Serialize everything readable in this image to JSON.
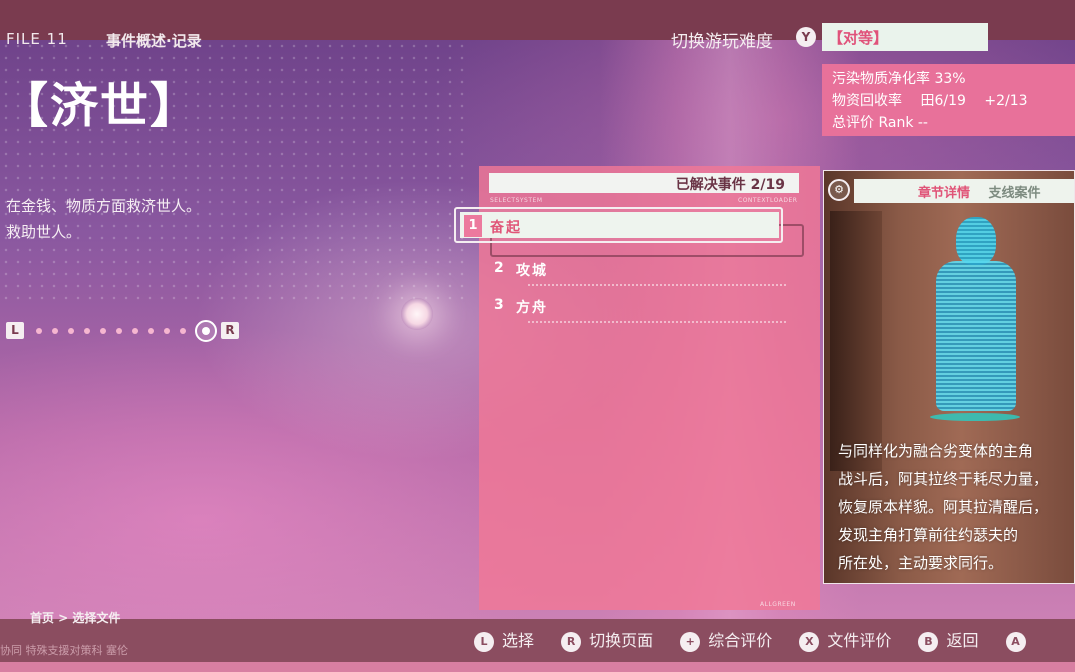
{
  "header": {
    "file_no": "FILE 11",
    "file_sub": "事件概述·记录",
    "title": "【济世】",
    "description": [
      "在金钱、物质方面救济世人。",
      "救助世人。"
    ]
  },
  "nav": {
    "left_btn": "L",
    "right_btn": "R"
  },
  "difficulty": {
    "label": "切换游玩难度",
    "button": "Y",
    "value": "【对等】"
  },
  "stats": {
    "purify": "污染物质净化率 33%",
    "recover_label": "物资回收率",
    "recover_a": "田6/19",
    "recover_b": "+2/13",
    "rank": "总评价 Rank --"
  },
  "panel": {
    "header": "已解决事件 2/19",
    "tiny_left": "SELECTSYSTEM",
    "tiny_right": "CONTEXTLOADER",
    "tiny_bottom": "ALLGREEN",
    "items": [
      {
        "num": "1",
        "label": "奋起"
      },
      {
        "num": "2",
        "label": "攻城"
      },
      {
        "num": "3",
        "label": "方舟"
      }
    ]
  },
  "card": {
    "medal": "⚙",
    "tab_active": "章节详情",
    "tab_inactive": "支线案件",
    "text": [
      "与同样化为融合劣变体的主角",
      "战斗后，阿其拉终于耗尽力量，",
      "恢复原本样貌。阿其拉清醒后，",
      "发现主角打算前往约瑟夫的",
      "所在处，主动要求同行。"
    ]
  },
  "breadcrumb": "首页 > 选择文件",
  "bottom_ghost": "协同   特殊支援对策科  塞伦",
  "hints": [
    {
      "key": "L",
      "label": "选择",
      "icon": "l-button-icon"
    },
    {
      "key": "R",
      "label": "切换页面",
      "icon": "r-button-icon"
    },
    {
      "key": "+",
      "label": "综合评价",
      "icon": "plus-button-icon"
    },
    {
      "key": "X",
      "label": "文件评价",
      "icon": "x-button-icon"
    },
    {
      "key": "B",
      "label": "返回",
      "icon": "b-button-icon"
    },
    {
      "key": "A",
      "label": "",
      "icon": "a-button-icon"
    }
  ],
  "colors": {
    "accent": "#e05478",
    "panel": "#f07896",
    "bar": "#7a3b4f"
  }
}
